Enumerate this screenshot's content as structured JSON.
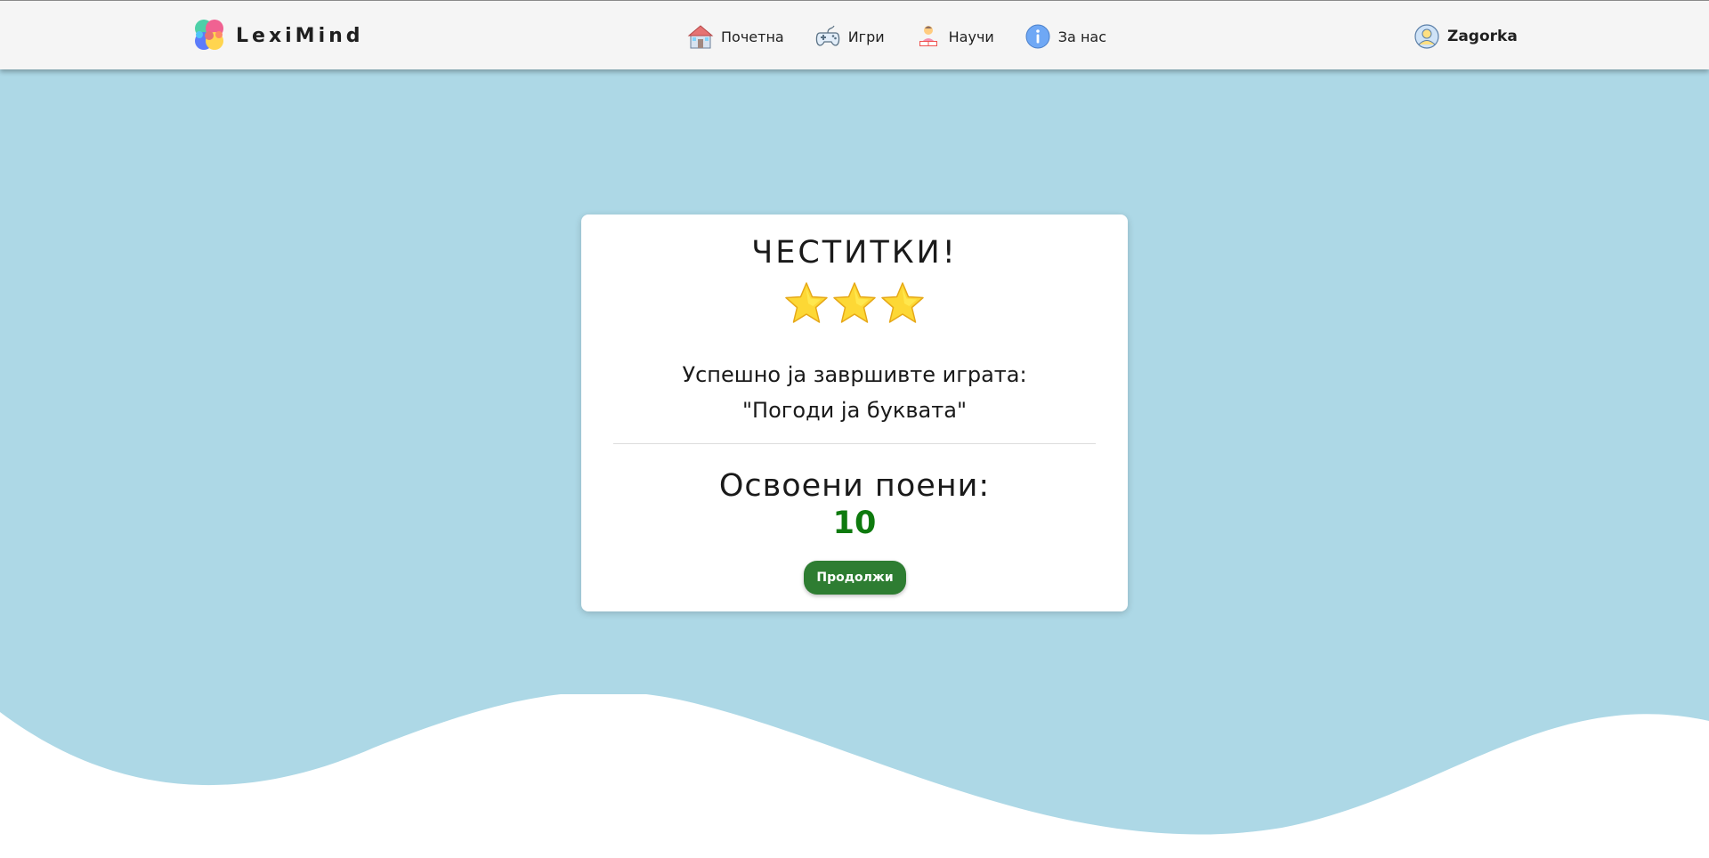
{
  "navbar": {
    "brand": "LexiMind",
    "links": [
      {
        "label": "Почетна",
        "icon": "house-icon"
      },
      {
        "label": "Игри",
        "icon": "gamepad-icon"
      },
      {
        "label": "Научи",
        "icon": "reading-person-icon"
      },
      {
        "label": "За нас",
        "icon": "info-icon"
      }
    ],
    "user": {
      "name": "Zagorka",
      "icon": "user-avatar-icon"
    }
  },
  "result_card": {
    "title": "ЧЕСТИТКИ!",
    "stars_earned": 3,
    "stars_total": 3,
    "message_line1": "Успешно ја завршивте играта:",
    "message_line2": "\"Погоди ја буквата\"",
    "points_label": "Освоени поени:",
    "points_value": "10",
    "continue_label": "Продолжи"
  },
  "colors": {
    "background": "#add8e6",
    "navbar": "#f5f5f5",
    "points": "#0e7a0e",
    "button": "#2e7d32",
    "star": "#fdd835"
  }
}
